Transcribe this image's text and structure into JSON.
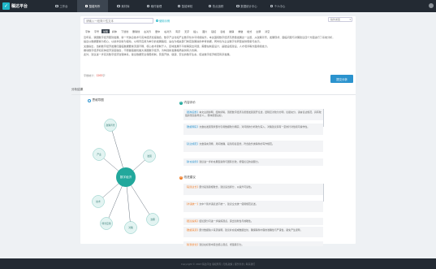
{
  "app": {
    "name": "稿达平台",
    "logo_glyph": "✓"
  },
  "nav": [
    {
      "label": "工作台",
      "icon": "dashboard-icon",
      "active": false
    },
    {
      "label": "智能写作",
      "icon": "pen-icon",
      "active": true
    },
    {
      "label": "素材库",
      "icon": "folder-icon",
      "active": false
    },
    {
      "label": "稿件管理",
      "icon": "document-icon",
      "active": false
    },
    {
      "label": "智能审校",
      "icon": "check-icon",
      "active": false
    },
    {
      "label": "热点追踪",
      "icon": "fire-icon",
      "active": false
    },
    {
      "label": "数据统计中心",
      "icon": "chart-icon",
      "active": false
    },
    {
      "label": "个人中心",
      "icon": "user-icon",
      "active": false
    }
  ],
  "input": {
    "placeholder": "请输入一段简介性文本",
    "example_label": "使用示例"
  },
  "select": {
    "value": "稿件类型"
  },
  "toolbar": [
    "字体",
    "字号",
    "加粗",
    "斜体",
    "下划线",
    "删除线",
    "左对齐",
    "居中",
    "右对齐",
    "有序",
    "无序",
    "插入",
    "图片",
    "链接",
    "表格",
    "撤销",
    "重做",
    "格式",
    "全屏",
    "清空"
  ],
  "toolbar_active_index": 2,
  "editor": {
    "paragraphs": [
      "近年来，我国数字经济蓬勃发展，新一代信息技术与实体经济加速融合，数字产业化和产业数字化水平持续提升。本文围绕数字经济高质量发展这一主题，从政策背景、发展现状、面临问题与对策建议四个方面进行了系统分析，",
      "提出以数据要素为核心、以技术创新为驱动、以场景应用为牵引的发展路径，旨在为相关部门制定政策提供参考依据，同时也为企业数字化转型提供借鉴与启示。",
      "文章指出，当前数字经济发展仍面临数据要素流通不畅、核心技术受制于人、区域发展不平衡等突出问题，需要在制度设计、基础设施建设、人才培养等方面持续发力，",
      "推动数字经济和实体经济深度融合，不断做强做优做大我国数字经济，为构建新发展格局提供有力支撑。",
      "此外，建议进一步完善数字经济治理体系，健全数据安全保障机制，营造开放、健康、安全的数字生态，促进数字经济规范有序发展。"
    ],
    "count_label": "字数统计：",
    "count_value": "1263",
    "count_suffix": "字",
    "submit": "提交分析"
  },
  "analysis": {
    "section_title": "分析结果",
    "mindmap_title": "思维导图",
    "center": "数字经济",
    "nodes": [
      "政策背景",
      "产业",
      "发展",
      "技术",
      "场景应用",
      "对策",
      "治理"
    ],
    "panel_a_title": "内容评价",
    "panel_a_items": [
      {
        "text": "本文主题鲜明、结构清晰，围绕数字经济高质量发展展开论述，逻辑层次较为分明，论据充分，语言表达规范，具有较强的现实指导意义。",
        "tag": "结构完整",
        "tail": "，整体质量良好。"
      },
      {
        "text": "文章在发展现状部分引用数据较为翔实，对问题的分析较为深入，对策建议具有一定的针对性和可操作性。",
        "tag": "数据翔实",
        "tail": ""
      },
      {
        "text": "文章语言流畅、用词准确，段落衔接自然，符合政务类稿件的写作规范。",
        "tag": "表达规范",
        "tail": ""
      },
      {
        "text": "建议进一步补充典型案例与国际比较，增强论证的说服力。",
        "tag": "补充案例",
        "tail": ""
      }
    ],
    "panel_b_title": "改进建议",
    "panel_b_items": [
      {
        "text": "部分段落篇幅较长，建议适当拆分，以提升可读性。",
        "warn": "段落过长",
        "tail": ""
      },
      {
        "text": "文中个别术语表述不统一，建议全文统一使用规范表述。",
        "warn": "术语统一",
        "tail": ""
      },
      {
        "text": "结论部分可进一步提炼观点，突出创新性与前瞻性。",
        "warn": "结论提炼",
        "tail": ""
      },
      {
        "text": "部分数据缺少来源说明，建议补充权威数据出处，确保稿件内容的准确性与严谨性，避免产生误导。",
        "warn": "数据来源",
        "tail": ""
      },
      {
        "text": "建议在标题中突出核心观点，增强吸引力。",
        "warn": "标题优化",
        "tail": ""
      }
    ]
  },
  "footer": "Copyright © 2023 稿达平台 版权所有 | 隐私政策 | 服务条款 | 联系我们"
}
